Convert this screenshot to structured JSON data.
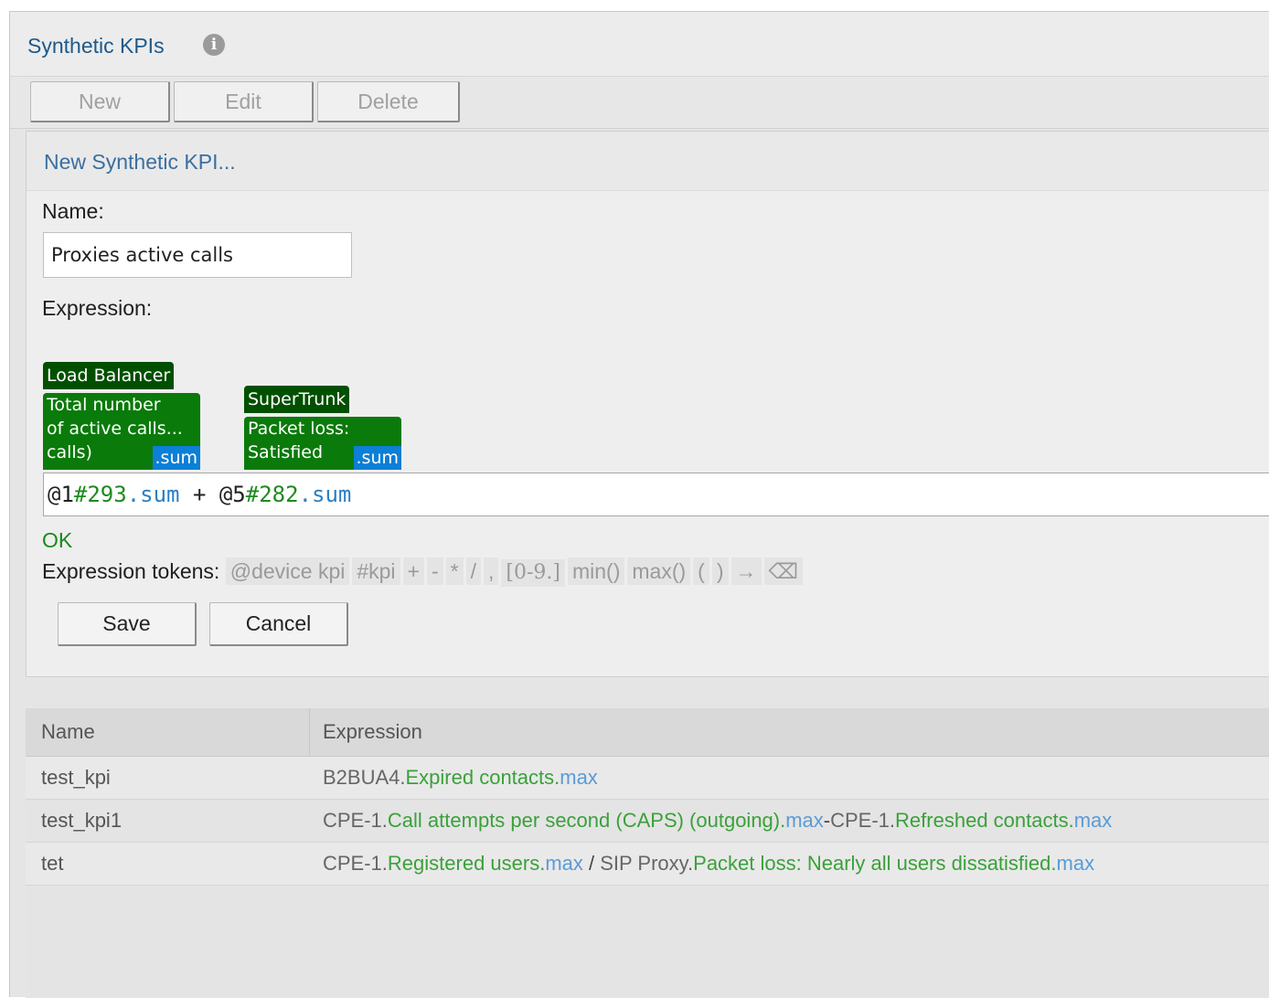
{
  "panel": {
    "title": "Synthetic KPIs",
    "info_icon": "info-icon"
  },
  "toolbar": {
    "new_label": "New",
    "edit_label": "Edit",
    "delete_label": "Delete"
  },
  "form": {
    "title": "New Synthetic KPI...",
    "name_label": "Name:",
    "name_value": "Proxies active calls",
    "expression_label": "Expression:",
    "chips": [
      {
        "device": "Load Balancer",
        "kpi_lines": [
          "Total number",
          "of active calls...",
          "calls)"
        ],
        "agg": ".sum"
      },
      {
        "device": "SuperTrunk",
        "kpi_lines": [
          "Packet loss:",
          "Satisfied"
        ],
        "agg": ".sum"
      }
    ],
    "expression": {
      "t1_device": "@1",
      "t1_kpi": "#293",
      "t1_agg": ".sum",
      "op": " + ",
      "t2_device": "@5",
      "t2_kpi": "#282",
      "t2_agg": ".sum"
    },
    "status": "OK",
    "tokens_label": "Expression tokens:",
    "tokens": [
      "@device kpi",
      "#kpi",
      "+",
      "-",
      "*",
      "/",
      ",",
      "[0-9.]",
      "min()",
      "max()",
      "(",
      ")",
      "→",
      "⌫"
    ],
    "save_label": "Save",
    "cancel_label": "Cancel"
  },
  "table": {
    "headers": [
      "Name",
      "Expression"
    ],
    "rows": [
      {
        "name": "test_kpi",
        "parts": [
          {
            "t": "B2BUA4.",
            "k": "dev"
          },
          {
            "t": "Expired contacts.",
            "k": "kpi"
          },
          {
            "t": "max",
            "k": "agg"
          }
        ]
      },
      {
        "name": "test_kpi1",
        "parts": [
          {
            "t": "CPE-1.",
            "k": "dev"
          },
          {
            "t": "Call attempts per second (CAPS) (outgoing).",
            "k": "kpi"
          },
          {
            "t": "max",
            "k": "agg"
          },
          {
            "t": "-",
            "k": "op"
          },
          {
            "t": "CPE-1.",
            "k": "dev"
          },
          {
            "t": "Refreshed contacts.",
            "k": "kpi"
          },
          {
            "t": "max",
            "k": "agg"
          }
        ]
      },
      {
        "name": "tet",
        "parts": [
          {
            "t": "CPE-1.",
            "k": "dev"
          },
          {
            "t": "Registered users.",
            "k": "kpi"
          },
          {
            "t": "max",
            "k": "agg"
          },
          {
            "t": " / ",
            "k": "op"
          },
          {
            "t": "SIP Proxy.",
            "k": "dev"
          },
          {
            "t": "Packet loss: Nearly all users dissatisfied.",
            "k": "kpi"
          },
          {
            "t": "max",
            "k": "agg"
          }
        ]
      }
    ]
  }
}
